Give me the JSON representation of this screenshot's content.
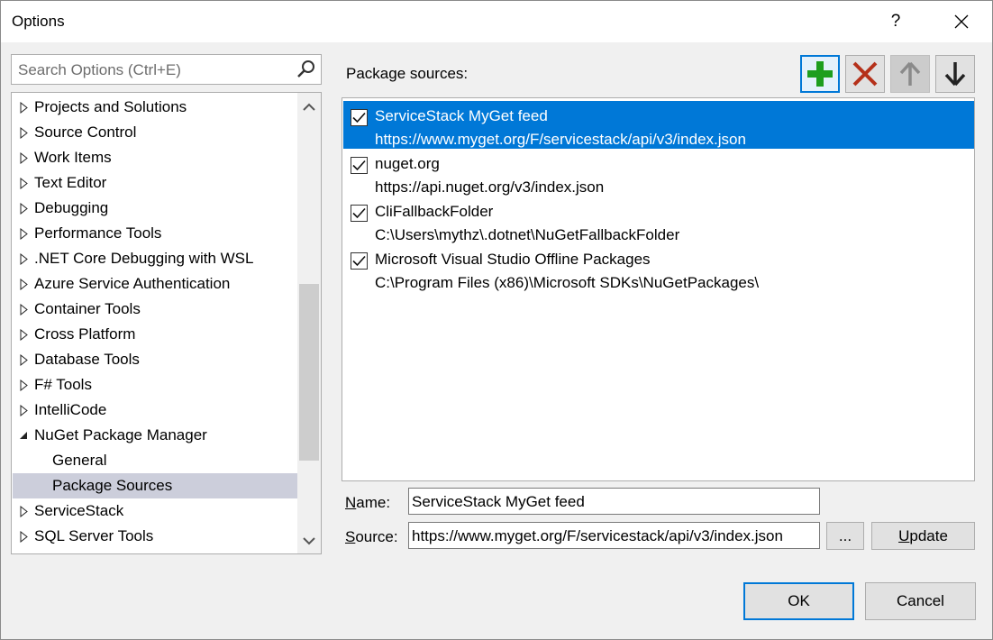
{
  "window": {
    "title": "Options",
    "help_label": "?"
  },
  "search": {
    "placeholder": "Search Options (Ctrl+E)"
  },
  "tree": {
    "items": [
      {
        "label": "Projects and Solutions",
        "expanded": false,
        "indent": 0,
        "selected": false
      },
      {
        "label": "Source Control",
        "expanded": false,
        "indent": 0,
        "selected": false
      },
      {
        "label": "Work Items",
        "expanded": false,
        "indent": 0,
        "selected": false
      },
      {
        "label": "Text Editor",
        "expanded": false,
        "indent": 0,
        "selected": false
      },
      {
        "label": "Debugging",
        "expanded": false,
        "indent": 0,
        "selected": false
      },
      {
        "label": "Performance Tools",
        "expanded": false,
        "indent": 0,
        "selected": false
      },
      {
        "label": ".NET Core Debugging with WSL",
        "expanded": false,
        "indent": 0,
        "selected": false
      },
      {
        "label": "Azure Service Authentication",
        "expanded": false,
        "indent": 0,
        "selected": false
      },
      {
        "label": "Container Tools",
        "expanded": false,
        "indent": 0,
        "selected": false
      },
      {
        "label": "Cross Platform",
        "expanded": false,
        "indent": 0,
        "selected": false
      },
      {
        "label": "Database Tools",
        "expanded": false,
        "indent": 0,
        "selected": false
      },
      {
        "label": "F# Tools",
        "expanded": false,
        "indent": 0,
        "selected": false
      },
      {
        "label": "IntelliCode",
        "expanded": false,
        "indent": 0,
        "selected": false
      },
      {
        "label": "NuGet Package Manager",
        "expanded": true,
        "indent": 0,
        "selected": false
      },
      {
        "label": "General",
        "expanded": null,
        "indent": 1,
        "selected": false
      },
      {
        "label": "Package Sources",
        "expanded": null,
        "indent": 1,
        "selected": true
      },
      {
        "label": "ServiceStack",
        "expanded": false,
        "indent": 0,
        "selected": false
      },
      {
        "label": "SQL Server Tools",
        "expanded": false,
        "indent": 0,
        "selected": false
      }
    ]
  },
  "package_sources": {
    "label": "Package sources:",
    "toolbar": {
      "add_icon": "plus-icon",
      "remove_icon": "x-icon",
      "up_icon": "arrow-up-icon",
      "down_icon": "arrow-down-icon"
    },
    "items": [
      {
        "name": "ServiceStack MyGet feed",
        "url": "https://www.myget.org/F/servicestack/api/v3/index.json",
        "checked": true,
        "selected": true
      },
      {
        "name": "nuget.org",
        "url": "https://api.nuget.org/v3/index.json",
        "checked": true,
        "selected": false
      },
      {
        "name": "CliFallbackFolder",
        "url": "C:\\Users\\mythz\\.dotnet\\NuGetFallbackFolder",
        "checked": true,
        "selected": false
      },
      {
        "name": "Microsoft Visual Studio Offline Packages",
        "url": "C:\\Program Files (x86)\\Microsoft SDKs\\NuGetPackages\\",
        "checked": true,
        "selected": false
      }
    ]
  },
  "form": {
    "name_label_prefix": "N",
    "name_label_rest": "ame:",
    "name_value": "ServiceStack MyGet feed",
    "source_label_prefix": "S",
    "source_label_rest": "ource:",
    "source_value": "https://www.myget.org/F/servicestack/api/v3/index.json",
    "browse_label": "...",
    "update_label_prefix": "U",
    "update_label_rest": "pdate"
  },
  "buttons": {
    "ok_label": "OK",
    "cancel_label": "Cancel"
  },
  "colors": {
    "accent": "#0078d7",
    "tree_selected": "#cccedb",
    "add_green": "#1e9e1e",
    "remove_red": "#b5311a"
  }
}
